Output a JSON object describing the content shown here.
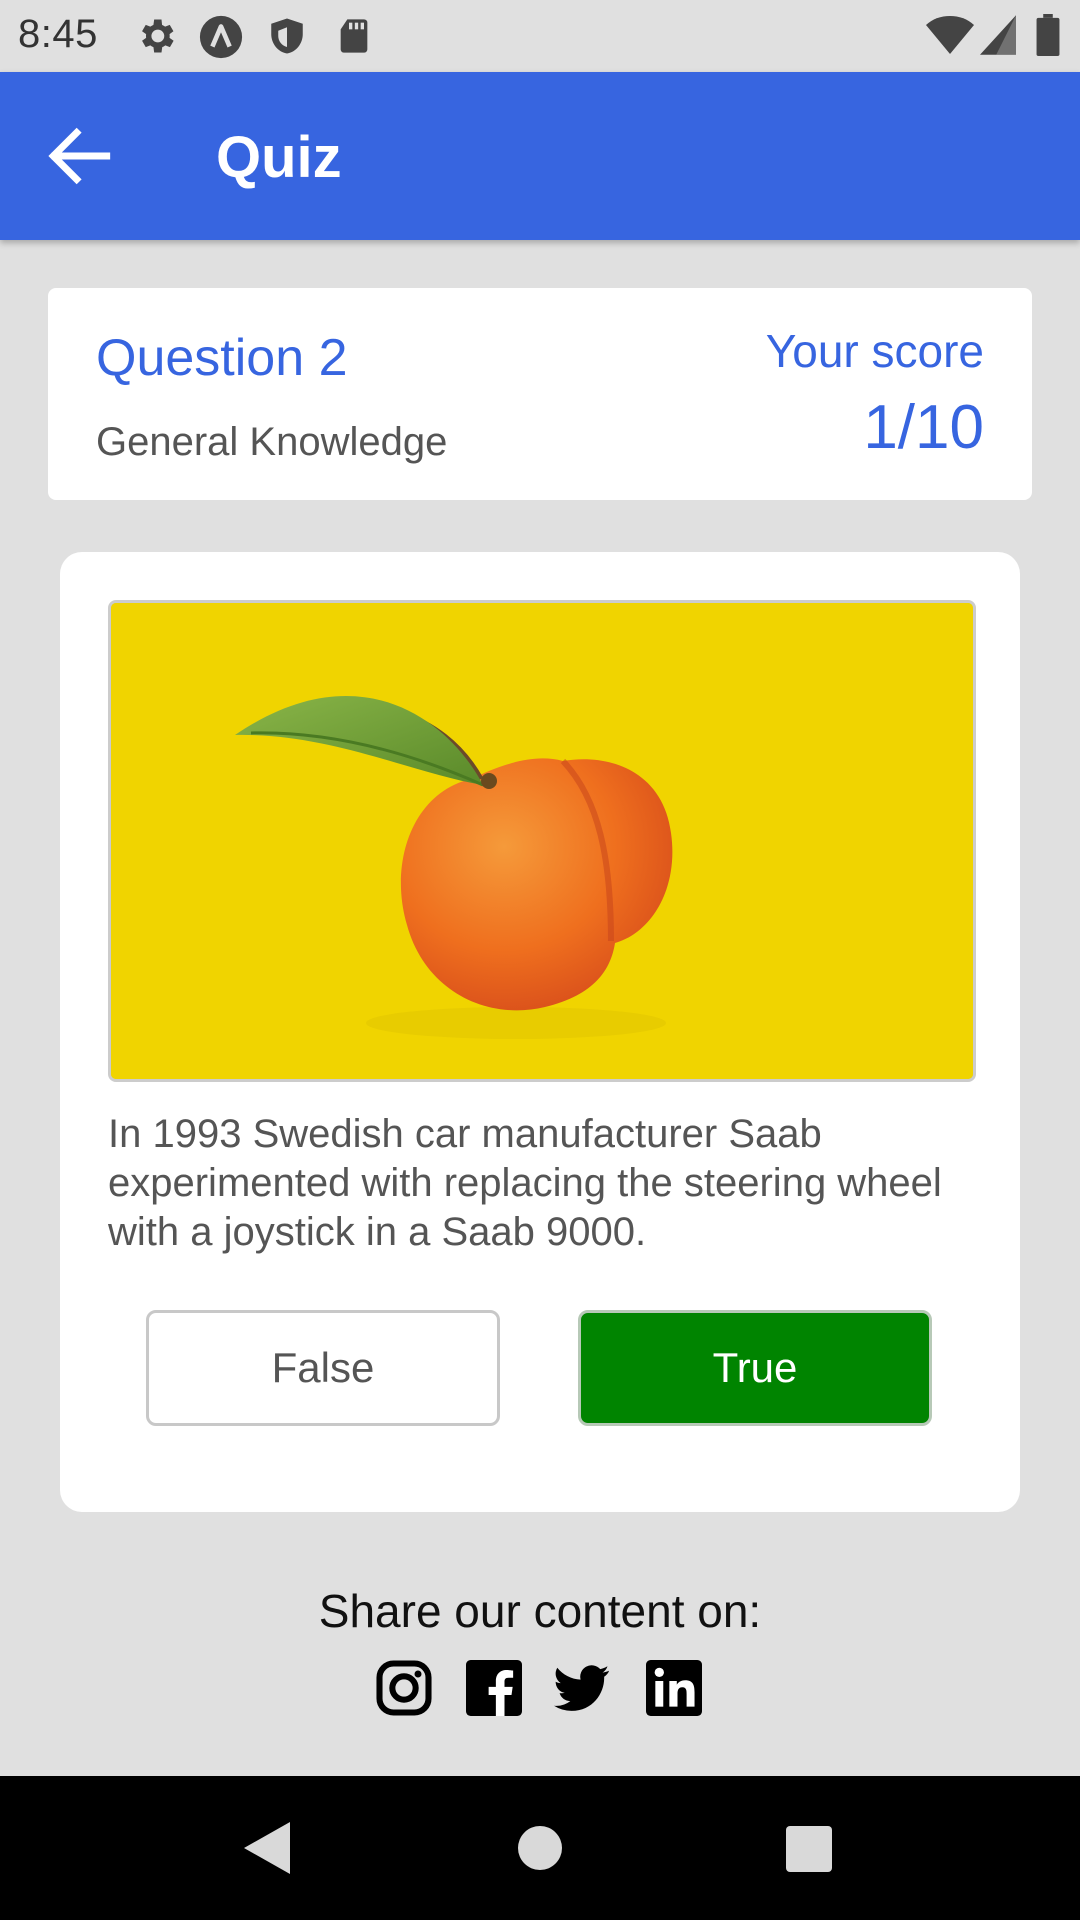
{
  "status_bar": {
    "time": "8:45",
    "left_icons": [
      "settings-icon",
      "app-a-icon",
      "shield-icon",
      "sd-card-icon"
    ],
    "right_icons": [
      "wifi-icon",
      "signal-icon",
      "battery-icon"
    ]
  },
  "app_bar": {
    "back_icon": "arrow-left-icon",
    "title": "Quiz",
    "background": "#3765e0"
  },
  "info": {
    "question_label": "Question 2",
    "category": "General Knowledge",
    "score_label": "Your score",
    "score_value": "1/10"
  },
  "question": {
    "image_subject": "peach-with-leaf",
    "image_background": "#f0d400",
    "text": "In 1993 Swedish car manufacturer Saab experimented with replacing the steering wheel with a joystick in a Saab 9000.",
    "answers": {
      "false_label": "False",
      "true_label": "True",
      "true_color": "#008400"
    }
  },
  "share": {
    "text": "Share our content on:",
    "icons": [
      "instagram-icon",
      "facebook-icon",
      "twitter-icon",
      "linkedin-icon"
    ]
  },
  "nav_bar": {
    "icons": [
      "back-triangle-icon",
      "home-circle-icon",
      "recents-square-icon"
    ]
  }
}
